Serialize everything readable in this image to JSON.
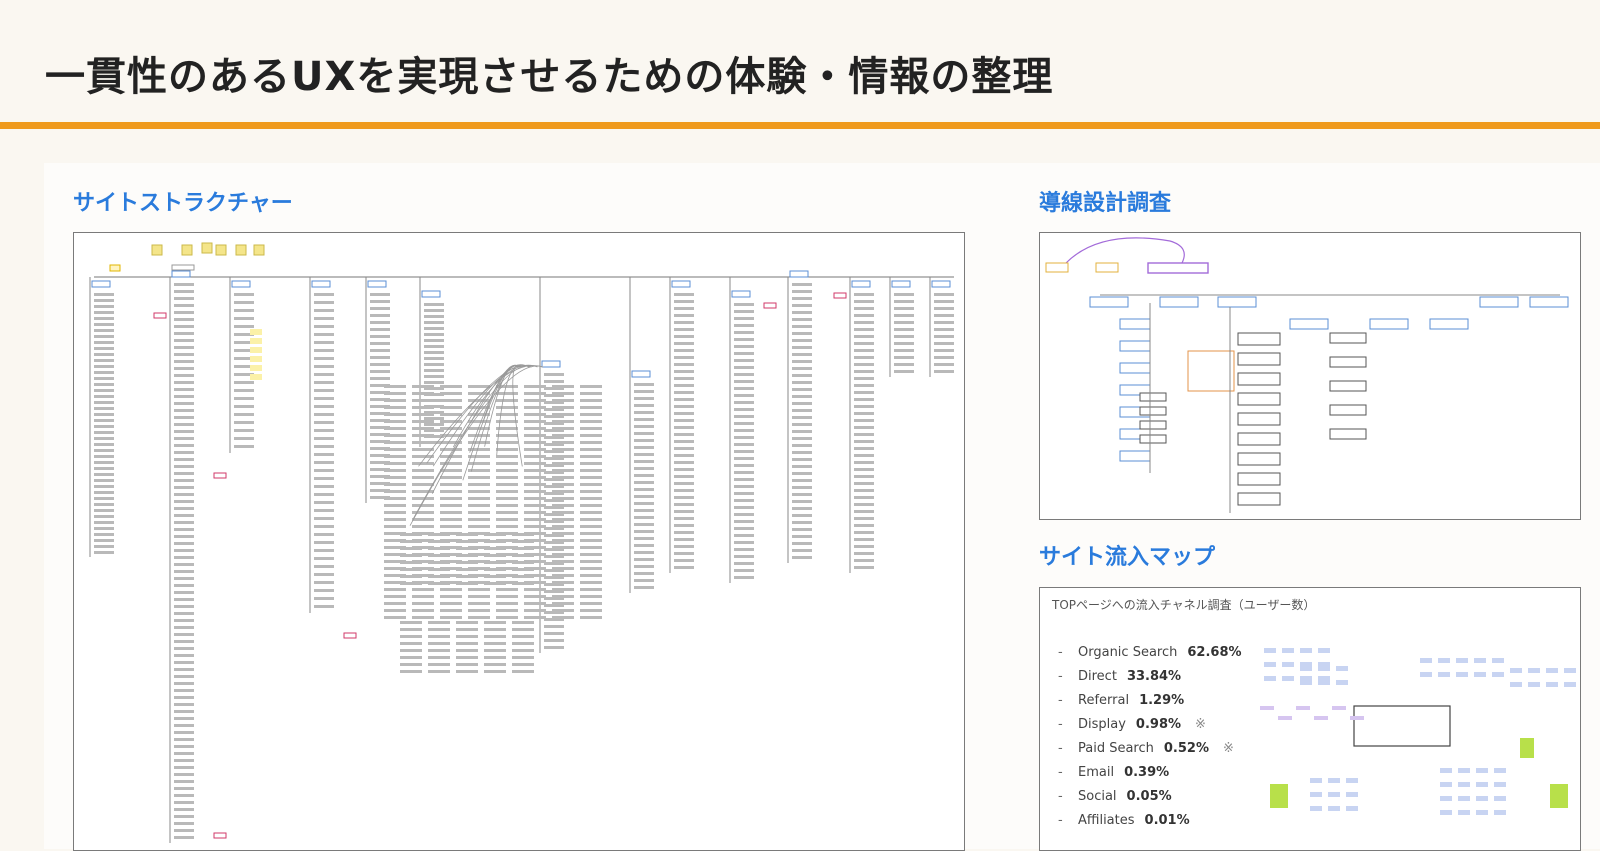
{
  "header": {
    "title": "一貫性のあるUXを実現させるための体験・情報の整理"
  },
  "colors": {
    "accent": "#ef9a1d",
    "section_title": "#2a7bdc",
    "background": "#faf7f1"
  },
  "sections": {
    "site_structure": {
      "title": "サイトストラクチャー"
    },
    "flow_design": {
      "title": "導線設計調査"
    },
    "traffic_map": {
      "title": "サイト流入マップ",
      "panel_heading": "TOPページへの流入チャネル調査（ユーザー数）",
      "channels": [
        {
          "name": "Organic Search",
          "percent": "62.68%",
          "note": ""
        },
        {
          "name": "Direct",
          "percent": "33.84%",
          "note": ""
        },
        {
          "name": "Referral",
          "percent": "1.29%",
          "note": ""
        },
        {
          "name": "Display",
          "percent": "0.98%",
          "note": "※"
        },
        {
          "name": "Paid Search",
          "percent": "0.52%",
          "note": "※"
        },
        {
          "name": "Email",
          "percent": "0.39%",
          "note": ""
        },
        {
          "name": "Social",
          "percent": "0.05%",
          "note": ""
        },
        {
          "name": "Affiliates",
          "percent": "0.01%",
          "note": ""
        }
      ]
    }
  }
}
